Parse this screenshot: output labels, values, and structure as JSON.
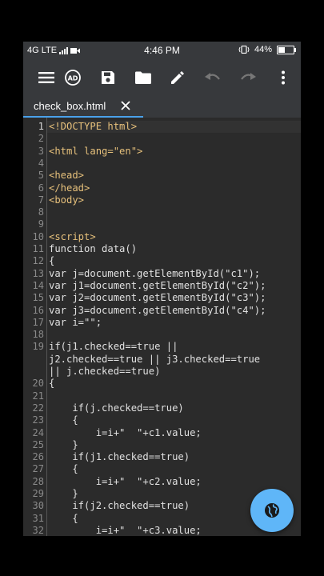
{
  "status_bar": {
    "network": "4G LTE",
    "time": "4:46 PM",
    "battery": "44%",
    "battery_level": 0.44
  },
  "toolbar": {
    "icons": [
      "menu-icon",
      "ad-icon",
      "save-icon",
      "folder-icon",
      "edit-icon",
      "undo-icon",
      "redo-icon",
      "more-vert-icon"
    ]
  },
  "tab": {
    "label": "check_box.html",
    "close": "✕"
  },
  "editor": {
    "active_line": 1,
    "rows": [
      {
        "n": "1",
        "t": "<!DOCTYPE html>",
        "tag": true
      },
      {
        "n": "2",
        "t": ""
      },
      {
        "n": "3",
        "t": "<html lang=\"en\">",
        "tag": true
      },
      {
        "n": "4",
        "t": ""
      },
      {
        "n": "5",
        "t": "<head>",
        "tag": true
      },
      {
        "n": "6",
        "t": "</head>",
        "tag": true
      },
      {
        "n": "7",
        "t": "<body>",
        "tag": true
      },
      {
        "n": "8",
        "t": ""
      },
      {
        "n": "9",
        "t": ""
      },
      {
        "n": "10",
        "t": "<script>",
        "tag": true
      },
      {
        "n": "11",
        "t": "function data()"
      },
      {
        "n": "12",
        "t": "{"
      },
      {
        "n": "13",
        "t": "var j=document.getElementById(\"c1\");"
      },
      {
        "n": "14",
        "t": "var j1=document.getElementById(\"c2\");"
      },
      {
        "n": "15",
        "t": "var j2=document.getElementById(\"c3\");"
      },
      {
        "n": "16",
        "t": "var j3=document.getElementById(\"c4\");"
      },
      {
        "n": "17",
        "t": "var i=\"\";"
      },
      {
        "n": "18",
        "t": ""
      },
      {
        "n": "19",
        "t": "if(j1.checked==true ||"
      },
      {
        "n": "",
        "t": "j2.checked==true || j3.checked==true"
      },
      {
        "n": "",
        "t": "|| j.checked==true)"
      },
      {
        "n": "20",
        "t": "{"
      },
      {
        "n": "21",
        "t": ""
      },
      {
        "n": "22",
        "t": "    if(j.checked==true)"
      },
      {
        "n": "23",
        "t": "    {"
      },
      {
        "n": "24",
        "t": "        i=i+\"  \"+c1.value;"
      },
      {
        "n": "25",
        "t": "    }"
      },
      {
        "n": "26",
        "t": "    if(j1.checked==true)"
      },
      {
        "n": "27",
        "t": "    {"
      },
      {
        "n": "28",
        "t": "        i=i+\"  \"+c2.value;"
      },
      {
        "n": "29",
        "t": "    }"
      },
      {
        "n": "30",
        "t": "    if(j2.checked==true)"
      },
      {
        "n": "31",
        "t": "    {"
      },
      {
        "n": "32",
        "t": "        i=i+\"  \"+c3.value;"
      }
    ]
  },
  "fab": {
    "icon": "globe-icon"
  }
}
